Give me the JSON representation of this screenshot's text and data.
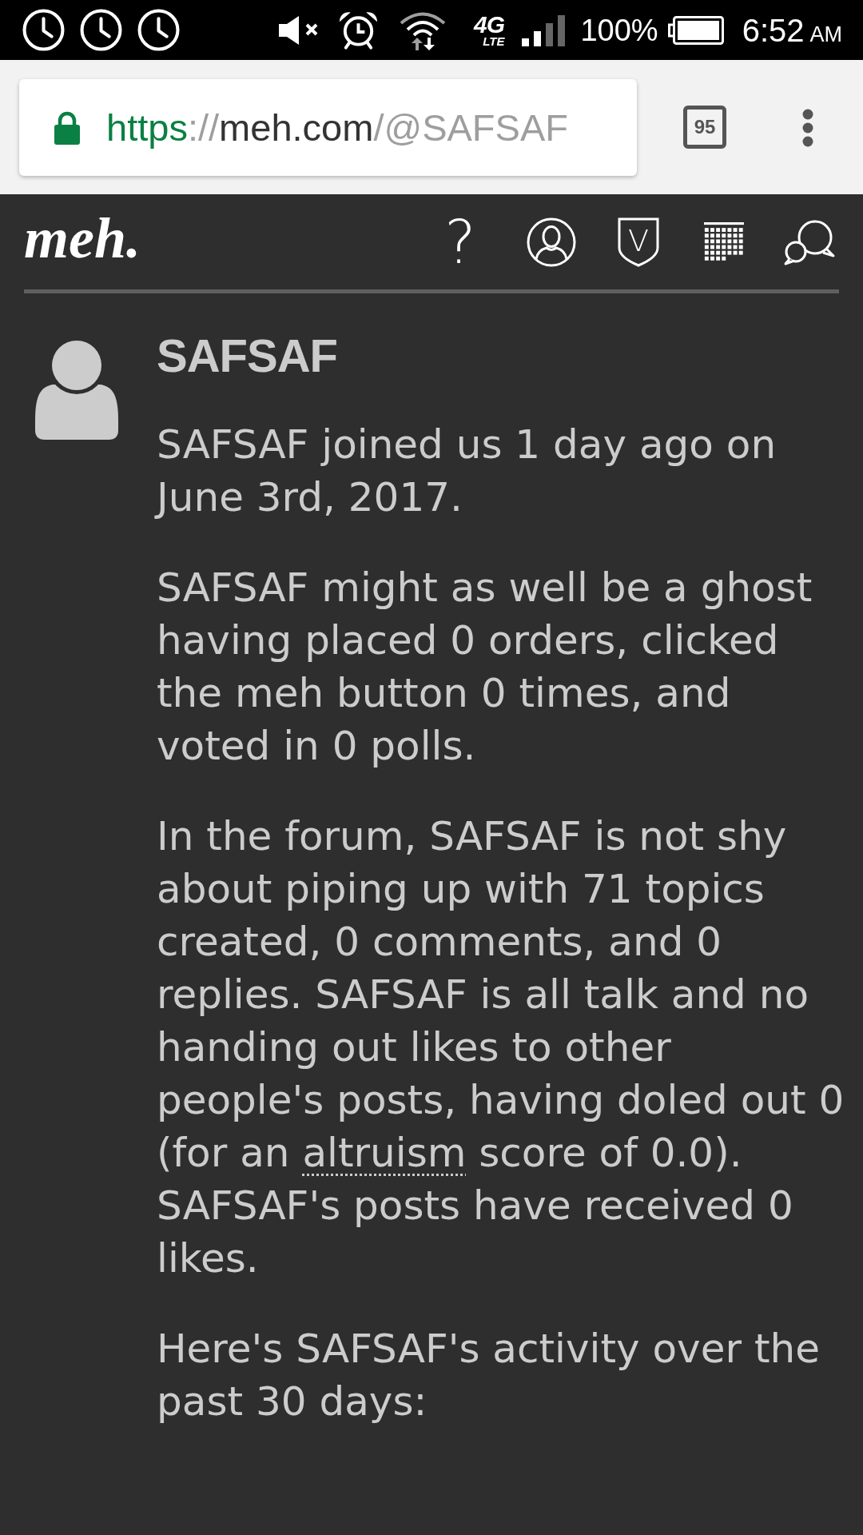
{
  "status_bar": {
    "notification_icons": [
      {
        "kind": "clock"
      },
      {
        "kind": "clock"
      },
      {
        "kind": "clock"
      }
    ],
    "network_type": "4G",
    "network_subtype": "LTE",
    "battery_text": "100%",
    "time": "6:52",
    "time_period": "AM"
  },
  "browser": {
    "url": [
      {
        "kind": "scheme",
        "text": "https"
      },
      {
        "kind": "dim",
        "text": "://"
      },
      {
        "kind": "host",
        "text": "meh.com"
      },
      {
        "kind": "dim",
        "text": "/@SAFSAF"
      }
    ],
    "tab_count": "95"
  },
  "site_header": {
    "logo": "meh.",
    "nav": [
      {
        "kind": "help",
        "label": "?"
      },
      {
        "kind": "account"
      },
      {
        "kind": "badge",
        "label": "V"
      },
      {
        "kind": "calendar"
      },
      {
        "kind": "chat"
      }
    ]
  },
  "profile": {
    "username": "SAFSAF",
    "paragraphs": [
      {
        "segments": [
          {
            "kind": "plain",
            "text": "SAFSAF joined us 1 day ago on June 3rd, 2017."
          }
        ]
      },
      {
        "segments": [
          {
            "kind": "plain",
            "text": "SAFSAF might as well be a ghost having placed 0 orders, clicked the meh button 0 times, and voted in 0 polls."
          }
        ]
      },
      {
        "segments": [
          {
            "kind": "plain",
            "text": "In the forum, SAFSAF is not shy about piping up with 71 topics created, 0 comments, and 0 replies. SAFSAF is all talk and no handing out likes to other people's posts, having doled out 0 (for an "
          },
          {
            "kind": "term",
            "text": "altruism"
          },
          {
            "kind": "plain",
            "text": " score of 0.0). SAFSAF's posts have received 0 likes."
          }
        ]
      },
      {
        "segments": [
          {
            "kind": "plain",
            "text": "Here's SAFSAF's activity over the past 30 days:"
          }
        ]
      }
    ]
  }
}
